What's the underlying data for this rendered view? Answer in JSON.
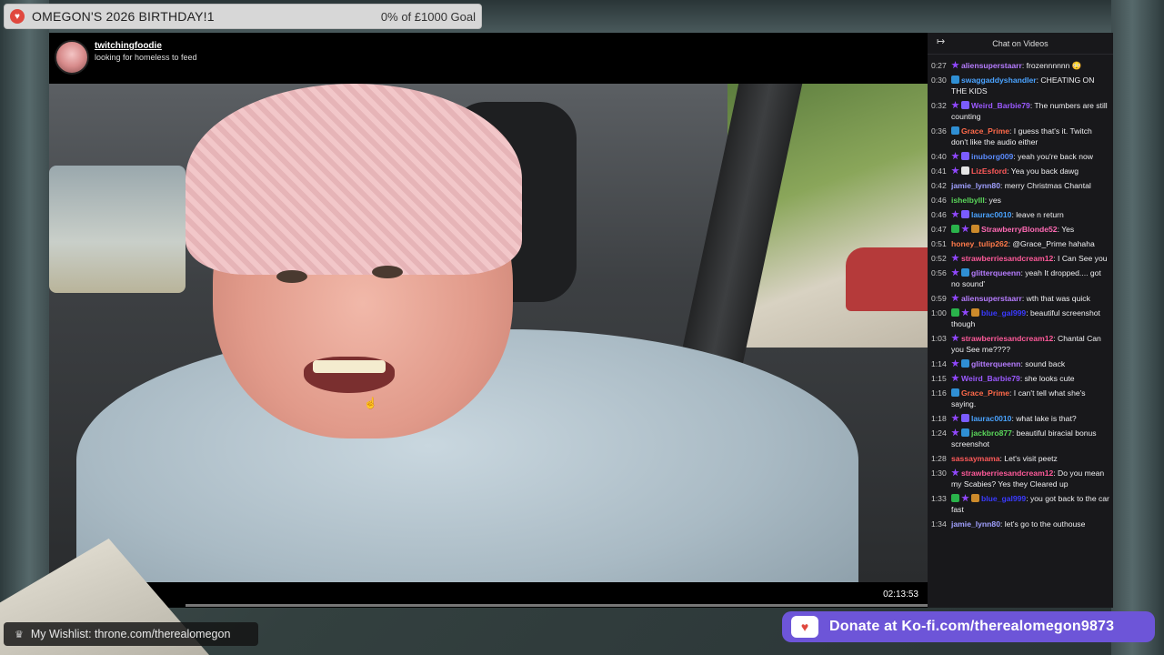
{
  "goal": {
    "title": "OMEGON'S 2026 BIRTHDAY!1",
    "progress": "0% of £1000 Goal",
    "progress_fraction": 0
  },
  "player": {
    "channel_name": "twitchingfoodie",
    "channel_status": "looking for homeless to feed",
    "time": "02:13:53"
  },
  "chat": {
    "title": "Chat on Videos",
    "collapse_icon": "collapse-arrow-icon",
    "messages": [
      {
        "ts": "0:27",
        "badges": [
          "star"
        ],
        "user": "aliensuperstaarr",
        "color": "#b67cff",
        "text": ": frozennnnnn 😳"
      },
      {
        "ts": "0:30",
        "badges": [
          "prime"
        ],
        "user": "swaggaddyshandler",
        "color": "#4aa3ff",
        "text": ": CHEATING ON THE KIDS"
      },
      {
        "ts": "0:32",
        "badges": [
          "star",
          "sub"
        ],
        "user": "Weird_Barbie79",
        "color": "#9b59ff",
        "text": ": The numbers are still counting"
      },
      {
        "ts": "0:36",
        "badges": [
          "prime"
        ],
        "user": "Grace_Prime",
        "color": "#ff6a4a",
        "text": ": I guess that's it. Twitch don't like the audio either"
      },
      {
        "ts": "0:40",
        "badges": [
          "star",
          "sub"
        ],
        "user": "inuborg009",
        "color": "#5b8cff",
        "text": ": yeah you're back now"
      },
      {
        "ts": "0:41",
        "badges": [
          "star",
          "vip"
        ],
        "user": "LizEsford",
        "color": "#ff5a5a",
        "text": ": Yea you back dawg"
      },
      {
        "ts": "0:42",
        "badges": [],
        "user": "jamie_lynn80",
        "color": "#a0a0ff",
        "text": ": merry Christmas Chantal"
      },
      {
        "ts": "0:46",
        "badges": [],
        "user": "ishelbylll",
        "color": "#5ad65a",
        "text": ": yes"
      },
      {
        "ts": "0:46",
        "badges": [
          "star",
          "sub"
        ],
        "user": "laurac0010",
        "color": "#4aa3ff",
        "text": ": leave n return"
      },
      {
        "ts": "0:47",
        "badges": [
          "mod",
          "star",
          "gift"
        ],
        "user": "StrawberryBlonde52",
        "color": "#ff6ab4",
        "text": ": Yes"
      },
      {
        "ts": "0:51",
        "badges": [],
        "user": "honey_tulip262",
        "color": "#ff7a4a",
        "text": ": @Grace_Prime hahaha"
      },
      {
        "ts": "0:52",
        "badges": [
          "star"
        ],
        "user": "strawberriesandcream12",
        "color": "#ff5a9a",
        "text": ": I Can See you"
      },
      {
        "ts": "0:56",
        "badges": [
          "star",
          "prime"
        ],
        "user": "glitterqueenn",
        "color": "#b67cff",
        "text": ": yeah It dropped.... got no sound'"
      },
      {
        "ts": "0:59",
        "badges": [
          "star"
        ],
        "user": "aliensuperstaarr",
        "color": "#b67cff",
        "text": ": wth that was quick"
      },
      {
        "ts": "1:00",
        "badges": [
          "mod",
          "star",
          "gift"
        ],
        "user": "blue_gal999",
        "color": "#3a3aff",
        "text": ": beautiful screenshot though"
      },
      {
        "ts": "1:03",
        "badges": [
          "star"
        ],
        "user": "strawberriesandcream12",
        "color": "#ff5a9a",
        "text": ": Chantal Can you See me????"
      },
      {
        "ts": "1:14",
        "badges": [
          "star",
          "prime"
        ],
        "user": "glitterqueenn",
        "color": "#b67cff",
        "text": ": sound back"
      },
      {
        "ts": "1:15",
        "badges": [
          "star"
        ],
        "user": "Weird_Barbie79",
        "color": "#9b59ff",
        "text": ": she looks cute"
      },
      {
        "ts": "1:16",
        "badges": [
          "prime"
        ],
        "user": "Grace_Prime",
        "color": "#ff6a4a",
        "text": ": I can't tell what she's saying."
      },
      {
        "ts": "1:18",
        "badges": [
          "star",
          "sub"
        ],
        "user": "laurac0010",
        "color": "#4aa3ff",
        "text": ": what lake is that?"
      },
      {
        "ts": "1:24",
        "badges": [
          "star",
          "prime"
        ],
        "user": "jackbro877",
        "color": "#5ad65a",
        "text": ": beautiful biracial bonus screenshot"
      },
      {
        "ts": "1:28",
        "badges": [],
        "user": "sassaymama",
        "color": "#ff5a5a",
        "text": ": Let's visit peetz"
      },
      {
        "ts": "1:30",
        "badges": [
          "star"
        ],
        "user": "strawberriesandcream12",
        "color": "#ff5a9a",
        "text": ": Do you mean my Scabies? Yes they Cleared up"
      },
      {
        "ts": "1:33",
        "badges": [
          "mod",
          "star",
          "gift"
        ],
        "user": "blue_gal999",
        "color": "#3a3aff",
        "text": ": you got back to the car fast"
      },
      {
        "ts": "1:34",
        "badges": [],
        "user": "jamie_lynn80",
        "color": "#a0a0ff",
        "text": ": let's go to the outhouse"
      }
    ]
  },
  "wishlist": {
    "icon": "crown-icon",
    "text": "My Wishlist: throne.com/therealomegon"
  },
  "donate": {
    "icon": "kofi-cup-icon",
    "text": "Donate at Ko-fi.com/therealomegon9873",
    "color": "#6d55d8"
  }
}
